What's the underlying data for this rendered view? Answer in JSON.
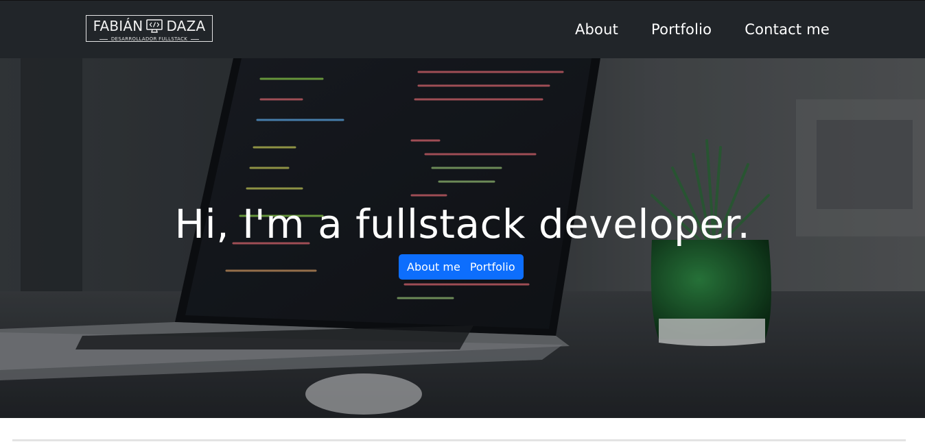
{
  "brand": {
    "name_left": "FABIÁN",
    "name_right": "DAZA",
    "tagline": "DESARROLLADOR FULLSTACK",
    "icon": "code-monitor-icon"
  },
  "nav": {
    "items": [
      {
        "label": "About"
      },
      {
        "label": "Portfolio"
      },
      {
        "label": "Contact me"
      }
    ]
  },
  "hero": {
    "title": "Hi, I'm a fullstack developer.",
    "buttons": [
      {
        "label": "About me"
      },
      {
        "label": "Portfolio"
      }
    ],
    "background": "laptop-with-code-and-plant-photo"
  },
  "colors": {
    "navbar": "#212529",
    "primary": "#0d6efd",
    "text_light": "#ffffff"
  }
}
